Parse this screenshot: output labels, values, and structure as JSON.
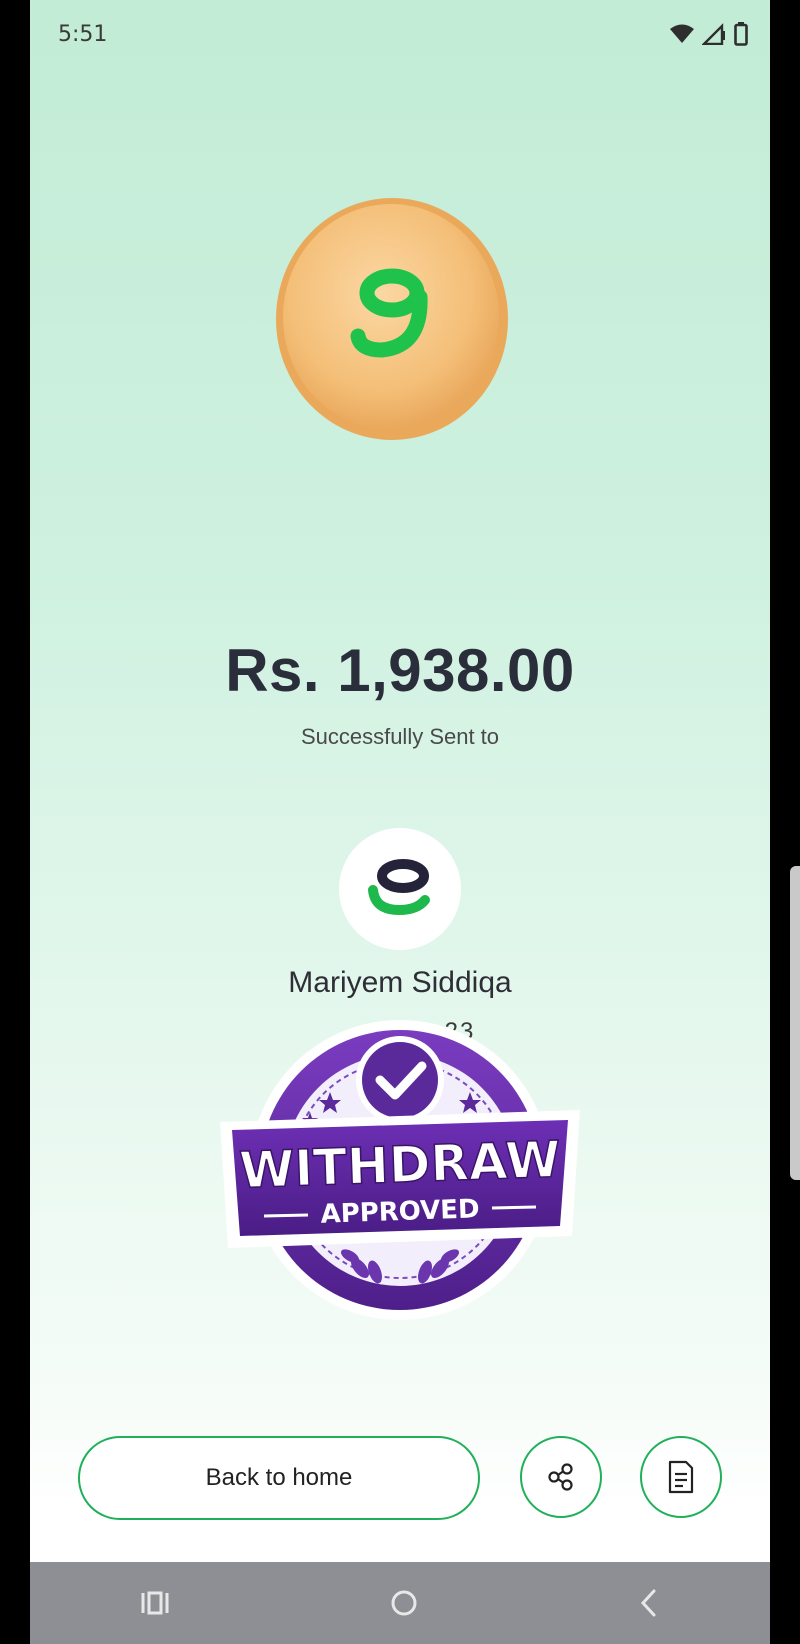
{
  "status_bar": {
    "time": "5:51",
    "icons": [
      "wifi-icon",
      "signal-icon",
      "battery-icon"
    ]
  },
  "transaction": {
    "amount": "Rs. 1,938.00",
    "status_text": "Successfully Sent to"
  },
  "recipient": {
    "name": "Mariyem Siddiqa",
    "number_visible": "23"
  },
  "badge": {
    "title": "WITHDRAW",
    "subtitle": "APPROVED"
  },
  "actions": {
    "back_label": "Back to home",
    "share_icon": "share-icon",
    "receipt_icon": "receipt-icon"
  },
  "colors": {
    "accent": "#20b05a",
    "badge_purple": "#5b2a9a",
    "coin": "#f5c07a"
  }
}
